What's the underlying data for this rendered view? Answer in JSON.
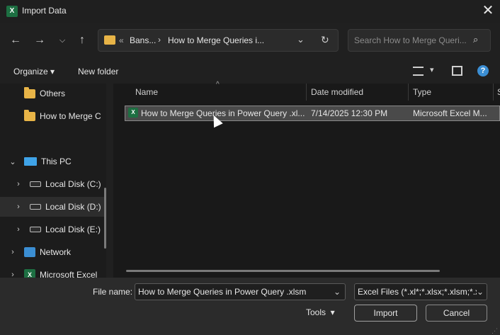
{
  "window": {
    "title": "Import Data",
    "app_icon_letter": "X"
  },
  "address": {
    "overflow": "«",
    "path": [
      "Bans...",
      "How to Merge Queries i..."
    ]
  },
  "search": {
    "placeholder": "Search How to Merge Queri..."
  },
  "toolbar": {
    "organize": "Organize",
    "new_folder": "New folder"
  },
  "nav": {
    "items": [
      {
        "label": "Others",
        "type": "folder"
      },
      {
        "label": "How to Merge C",
        "type": "folder"
      },
      {
        "label": "This PC",
        "type": "pc"
      },
      {
        "label": "Local Disk (C:)",
        "type": "drive"
      },
      {
        "label": "Local Disk (D:)",
        "type": "drive"
      },
      {
        "label": "Local Disk (E:)",
        "type": "drive"
      },
      {
        "label": "Network",
        "type": "network"
      },
      {
        "label": "Microsoft Excel",
        "type": "excel"
      }
    ]
  },
  "columns": {
    "name": "Name",
    "date": "Date modified",
    "type": "Type",
    "size": "S"
  },
  "files": [
    {
      "name": "How to Merge Queries in Power Query .xl...",
      "date": "7/14/2025 12:30 PM",
      "type": "Microsoft Excel M..."
    }
  ],
  "bottom": {
    "filename_label": "File name:",
    "filename_value": "How to Merge Queries in Power Query .xlsm",
    "filter_value": "Excel Files (*.xl*;*.xlsx;*.xlsm;*.xl",
    "tools": "Tools",
    "import": "Import",
    "cancel": "Cancel"
  },
  "colors": {
    "excel_green": "#1d6f42",
    "folder_yellow": "#e8b447",
    "help_blue": "#3b8ed3"
  }
}
